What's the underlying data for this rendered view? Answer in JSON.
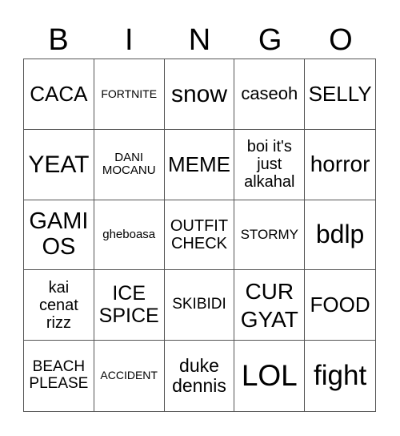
{
  "header": [
    "B",
    "I",
    "N",
    "G",
    "O"
  ],
  "cells": [
    "CACA",
    "FORTNITE",
    "snow",
    "caseoh",
    "SELLY",
    "YEAT",
    "DANI MOCANU",
    "MEME",
    "boi it's just alkahal",
    "horror",
    "GAMI OS",
    "gheboasa",
    "OUTFIT CHECK",
    "STORMY",
    "bdlp",
    "kai cenat rizz",
    "ICE SPICE",
    "SKIBIDI",
    "CUR GYAT",
    "FOOD",
    "BEACH PLEASE",
    "ACCIDENT",
    "duke dennis",
    "LOL",
    "fight"
  ]
}
